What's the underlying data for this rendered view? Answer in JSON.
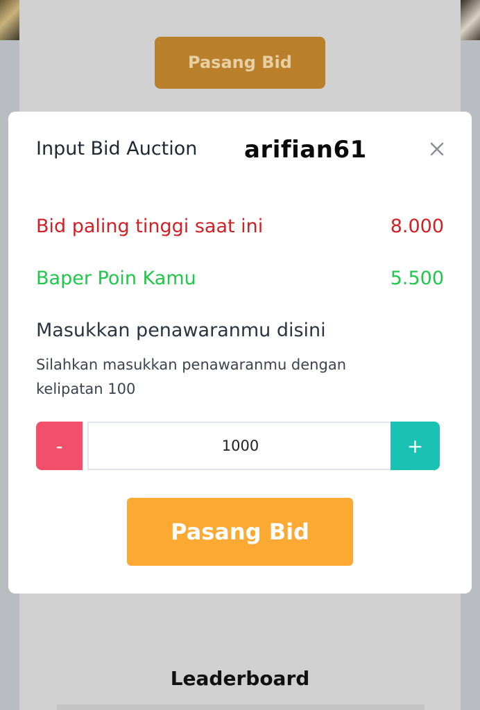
{
  "background": {
    "bid_button_label": "Pasang Bid",
    "leaderboard_title": "Leaderboard"
  },
  "modal": {
    "title": "Input Bid Auction",
    "watermark": "arifian61",
    "close_icon": "close-icon",
    "highest_bid": {
      "label": "Bid paling tinggi saat ini",
      "value": "8.000",
      "color": "#d21f25"
    },
    "points": {
      "label": "Baper Poin Kamu",
      "value": "5.500",
      "color": "#1fc74a"
    },
    "heading": "Masukkan penawaranmu disini",
    "help_text": "Silahkan masukkan penawaranmu dengan kelipatan 100",
    "stepper": {
      "minus_label": "-",
      "value": "1000",
      "plus_label": "+",
      "minus_color": "#f2506a",
      "plus_color": "#19c2b2"
    },
    "submit_label": "Pasang Bid",
    "submit_color": "#fba932"
  }
}
